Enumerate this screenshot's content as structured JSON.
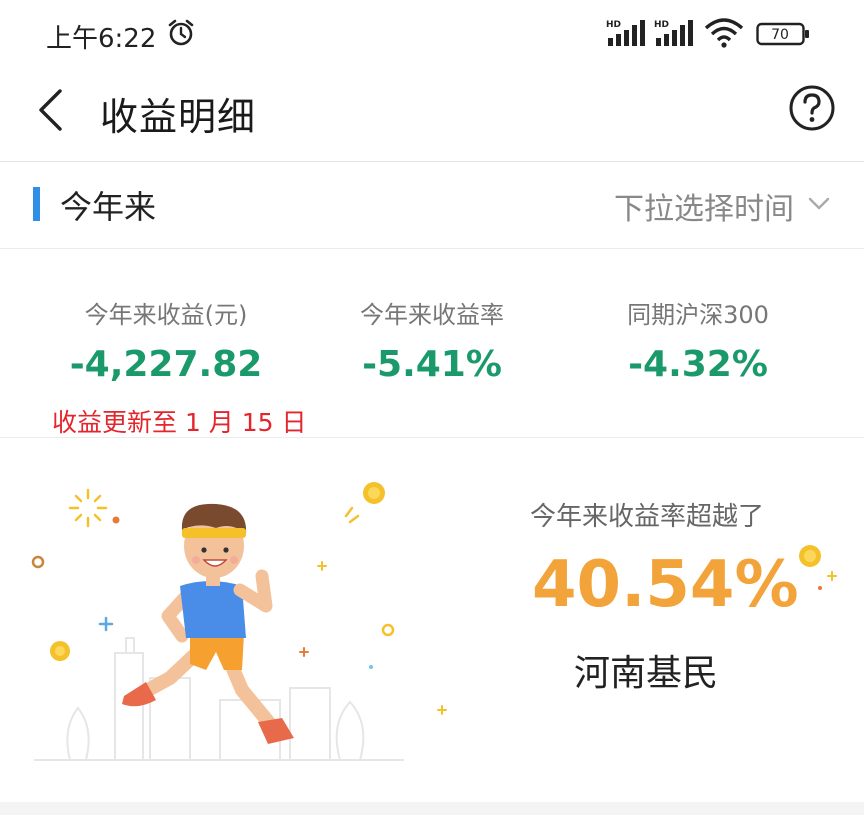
{
  "status_bar": {
    "time": "上午6:22",
    "signal1_label": "HD",
    "signal2_label": "HD",
    "battery": "70"
  },
  "header": {
    "title": "收益明细"
  },
  "period": {
    "label": "今年来",
    "picker_label": "下拉选择时间"
  },
  "stats": [
    {
      "label": "今年来收益(元)",
      "value": "-4,227.82"
    },
    {
      "label": "今年来收益率",
      "value": "-5.41%"
    },
    {
      "label": "同期沪深300",
      "value": "-4.32%"
    }
  ],
  "update_note": "收益更新至 1 月 15 日",
  "banner": {
    "subtitle": "今年来收益率超越了",
    "percent": "40.54%",
    "group": "河南基民"
  },
  "colors": {
    "accent": "#2f8fe6",
    "negative": "#1a9a6b",
    "highlight": "#f2a33a",
    "alert": "#e3262d"
  }
}
